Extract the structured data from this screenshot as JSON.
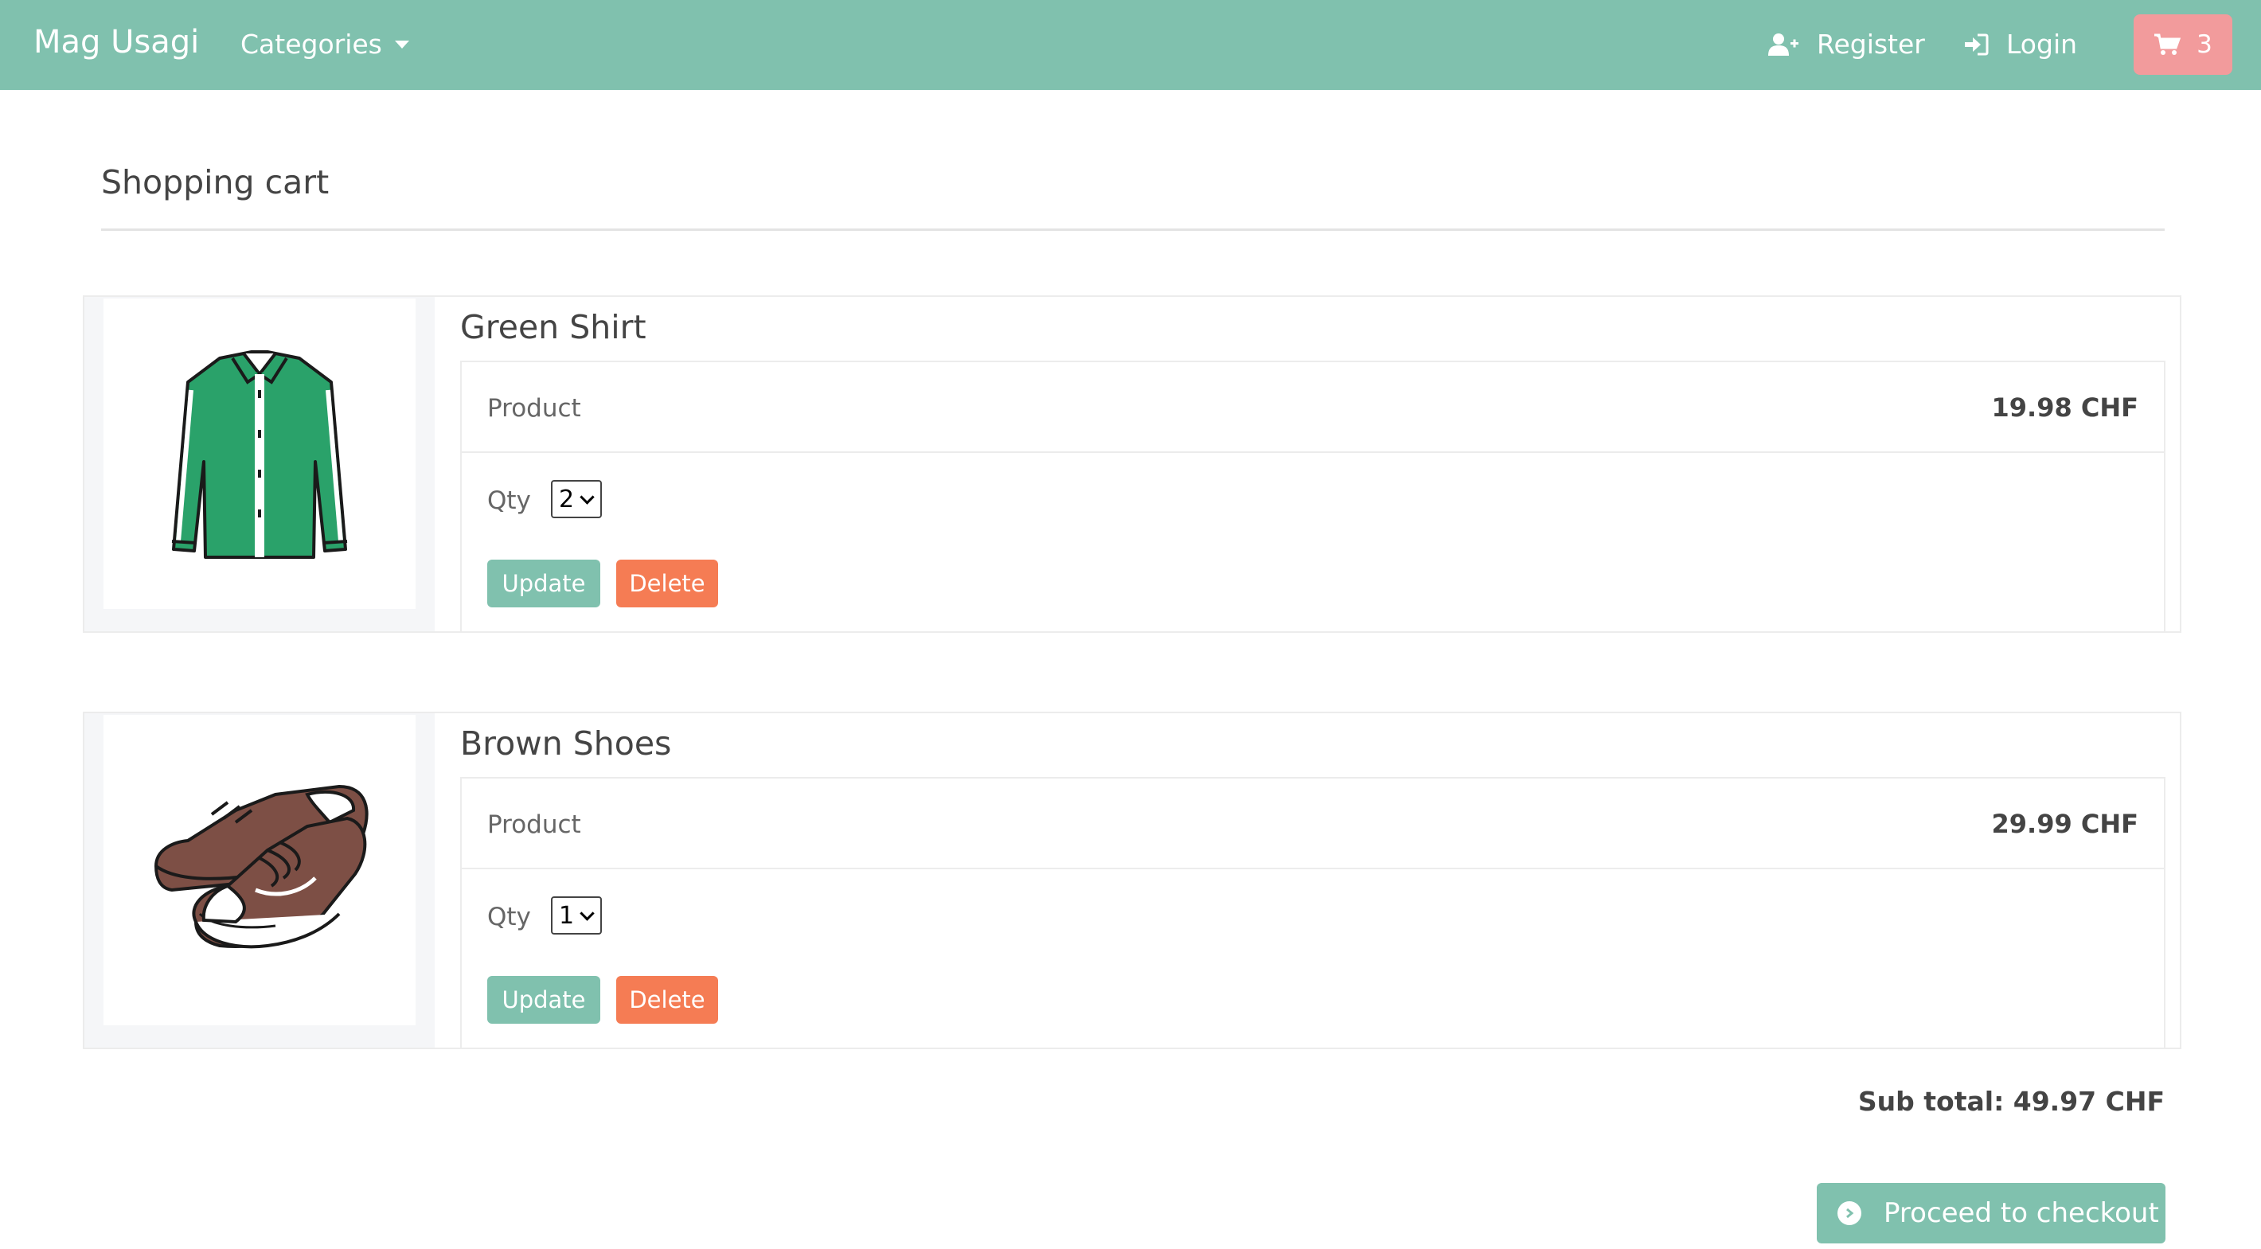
{
  "navbar": {
    "brand": "Mag Usagi",
    "categories_label": "Categories",
    "register_label": "Register",
    "login_label": "Login",
    "cart_count": "3",
    "color": "#80c1ae",
    "cart_color": "#f29b9c"
  },
  "page": {
    "title": "Shopping cart"
  },
  "cart_items": [
    {
      "name": "Green Shirt",
      "product_label": "Product",
      "price": "19.98 CHF",
      "qty_label": "Qty",
      "qty": "2",
      "update_label": "Update",
      "delete_label": "Delete",
      "image_icon": "green-shirt-icon"
    },
    {
      "name": "Brown Shoes",
      "product_label": "Product",
      "price": "29.99 CHF",
      "qty_label": "Qty",
      "qty": "1",
      "update_label": "Update",
      "delete_label": "Delete",
      "image_icon": "brown-shoes-icon"
    }
  ],
  "summary": {
    "subtotal": "Sub total: 49.97 CHF",
    "checkout_label": "Proceed to checkout"
  },
  "colors": {
    "primary": "#80c1ae",
    "danger": "#f57c54"
  }
}
